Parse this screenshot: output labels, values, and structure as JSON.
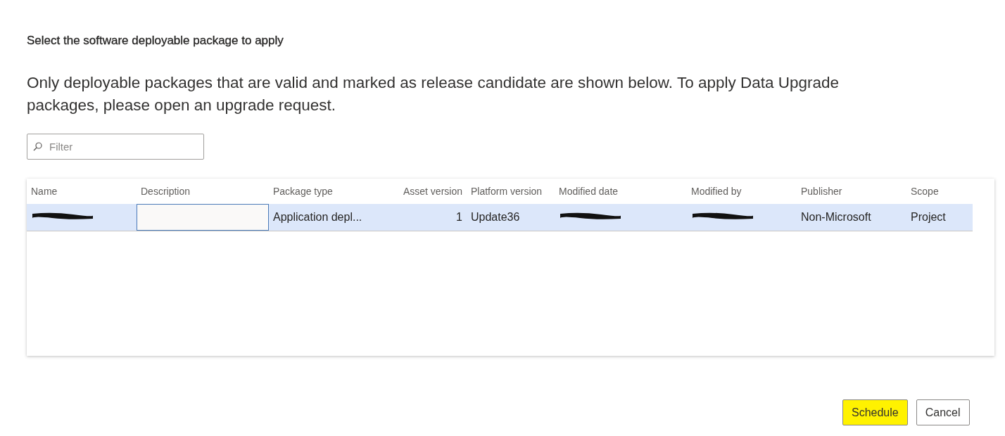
{
  "dialog": {
    "title": "Select the software deployable package to apply",
    "message": "Only deployable packages that are valid and marked as release candidate are shown below. To apply Data Upgrade packages, please open an upgrade request."
  },
  "filter": {
    "placeholder": "Filter"
  },
  "table": {
    "columns": [
      {
        "label": "Name",
        "kind": "text"
      },
      {
        "label": "Description",
        "kind": "text"
      },
      {
        "label": "Package type",
        "kind": "text"
      },
      {
        "label": "Asset version",
        "kind": "number"
      },
      {
        "label": "Platform version",
        "kind": "text"
      },
      {
        "label": "Modified date",
        "kind": "text"
      },
      {
        "label": "Modified by",
        "kind": "text"
      },
      {
        "label": "Publisher",
        "kind": "text"
      },
      {
        "label": "Scope",
        "kind": "text"
      }
    ],
    "rows": [
      {
        "selected": true,
        "cells": [
          {
            "kind": "redacted"
          },
          {
            "kind": "input"
          },
          {
            "kind": "text",
            "text": "Application depl..."
          },
          {
            "kind": "text",
            "text": "1"
          },
          {
            "kind": "text",
            "text": "Update36"
          },
          {
            "kind": "redacted"
          },
          {
            "kind": "redacted"
          },
          {
            "kind": "text",
            "text": "Non-Microsoft"
          },
          {
            "kind": "text",
            "text": "Project"
          }
        ]
      }
    ]
  },
  "buttons": [
    {
      "label": "Schedule",
      "highlighted": true
    },
    {
      "label": "Cancel",
      "highlighted": false
    }
  ]
}
